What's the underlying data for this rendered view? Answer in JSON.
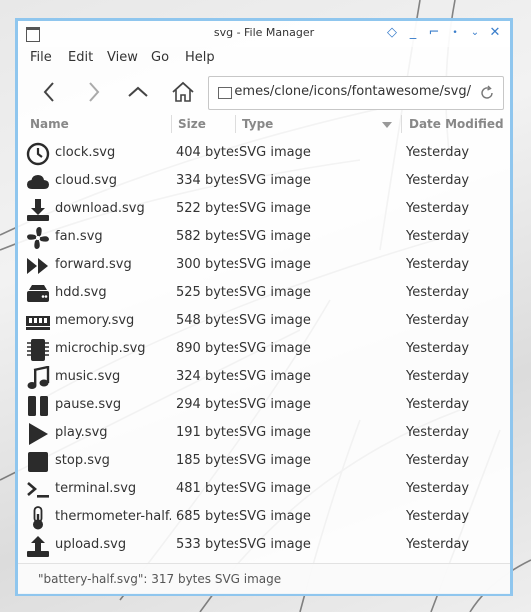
{
  "window": {
    "title": "svg - File Manager"
  },
  "menu": [
    "File",
    "Edit",
    "View",
    "Go",
    "Help"
  ],
  "path": {
    "value": "/usr/share/themes/clone/icons/fontawesome/svg/"
  },
  "columns": {
    "name": "Name",
    "size": "Size",
    "type": "Type",
    "date": "Date Modified"
  },
  "files": [
    {
      "name": "clock.svg",
      "size": "404 bytes",
      "type": "SVG image",
      "date": "Yesterday",
      "icon": "clock-icon"
    },
    {
      "name": "cloud.svg",
      "size": "334 bytes",
      "type": "SVG image",
      "date": "Yesterday",
      "icon": "cloud-icon"
    },
    {
      "name": "download.svg",
      "size": "522 bytes",
      "type": "SVG image",
      "date": "Yesterday",
      "icon": "download-icon"
    },
    {
      "name": "fan.svg",
      "size": "582 bytes",
      "type": "SVG image",
      "date": "Yesterday",
      "icon": "fan-icon"
    },
    {
      "name": "forward.svg",
      "size": "300 bytes",
      "type": "SVG image",
      "date": "Yesterday",
      "icon": "forward-icon"
    },
    {
      "name": "hdd.svg",
      "size": "525 bytes",
      "type": "SVG image",
      "date": "Yesterday",
      "icon": "hdd-icon"
    },
    {
      "name": "memory.svg",
      "size": "548 bytes",
      "type": "SVG image",
      "date": "Yesterday",
      "icon": "memory-icon"
    },
    {
      "name": "microchip.svg",
      "size": "890 bytes",
      "type": "SVG image",
      "date": "Yesterday",
      "icon": "microchip-icon"
    },
    {
      "name": "music.svg",
      "size": "324 bytes",
      "type": "SVG image",
      "date": "Yesterday",
      "icon": "music-icon"
    },
    {
      "name": "pause.svg",
      "size": "294 bytes",
      "type": "SVG image",
      "date": "Yesterday",
      "icon": "pause-icon"
    },
    {
      "name": "play.svg",
      "size": "191 bytes",
      "type": "SVG image",
      "date": "Yesterday",
      "icon": "play-icon"
    },
    {
      "name": "stop.svg",
      "size": "185 bytes",
      "type": "SVG image",
      "date": "Yesterday",
      "icon": "stop-icon"
    },
    {
      "name": "terminal.svg",
      "size": "481 bytes",
      "type": "SVG image",
      "date": "Yesterday",
      "icon": "terminal-icon"
    },
    {
      "name": "thermometer-half.svg",
      "size": "685 bytes",
      "type": "SVG image",
      "date": "Yesterday",
      "icon": "thermometer-half-icon"
    },
    {
      "name": "upload.svg",
      "size": "533 bytes",
      "type": "SVG image",
      "date": "Yesterday",
      "icon": "upload-icon"
    }
  ],
  "status": {
    "text": "\"battery-half.svg\": 317 bytes SVG image"
  },
  "colors": {
    "accent": "#8fc6ee",
    "titlebar_buttons": "#3a7ecb",
    "icon_fill": "#2b2b2b"
  }
}
